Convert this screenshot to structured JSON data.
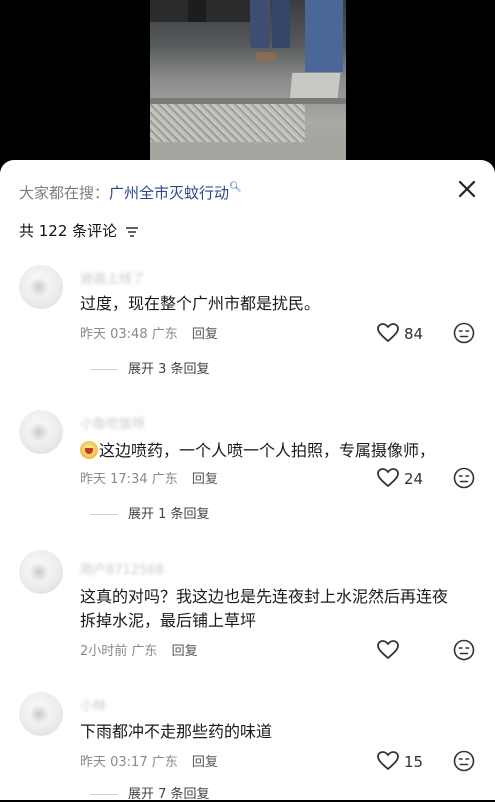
{
  "search": {
    "prefix": "大家都在搜：",
    "topic": "广州全市灭蚊行动"
  },
  "comment_count_label": "共 122 条评论",
  "comments": [
    {
      "text": "过度，现在整个广州市都是扰民。",
      "time": "昨天 03:48",
      "location": "广东",
      "reply": "回复",
      "likes": "84",
      "expand": "展开 3 条回复"
    },
    {
      "text": "这边喷药，一个人喷一个人拍照，专属摄像师，",
      "time": "昨天 17:34",
      "location": "广东",
      "reply": "回复",
      "likes": "24",
      "expand": "展开 1 条回复"
    },
    {
      "text_line1": "这真的对吗？我这边也是先连夜封上水泥然后再连夜",
      "text_line2": "拆掉水泥，最后铺上草坪",
      "time": "2小时前",
      "location": "广东",
      "reply": "回复",
      "likes": ""
    },
    {
      "text": "下雨都冲不走那些药的味道",
      "time": "昨天 03:17",
      "location": "广东",
      "reply": "回复",
      "likes": "15",
      "expand": "展开 7 条回复"
    }
  ],
  "icons": {
    "close": "close-icon",
    "sort": "sort-icon",
    "like": "heart-icon",
    "dislike": "neutral-face-icon",
    "search": "search-icon"
  }
}
